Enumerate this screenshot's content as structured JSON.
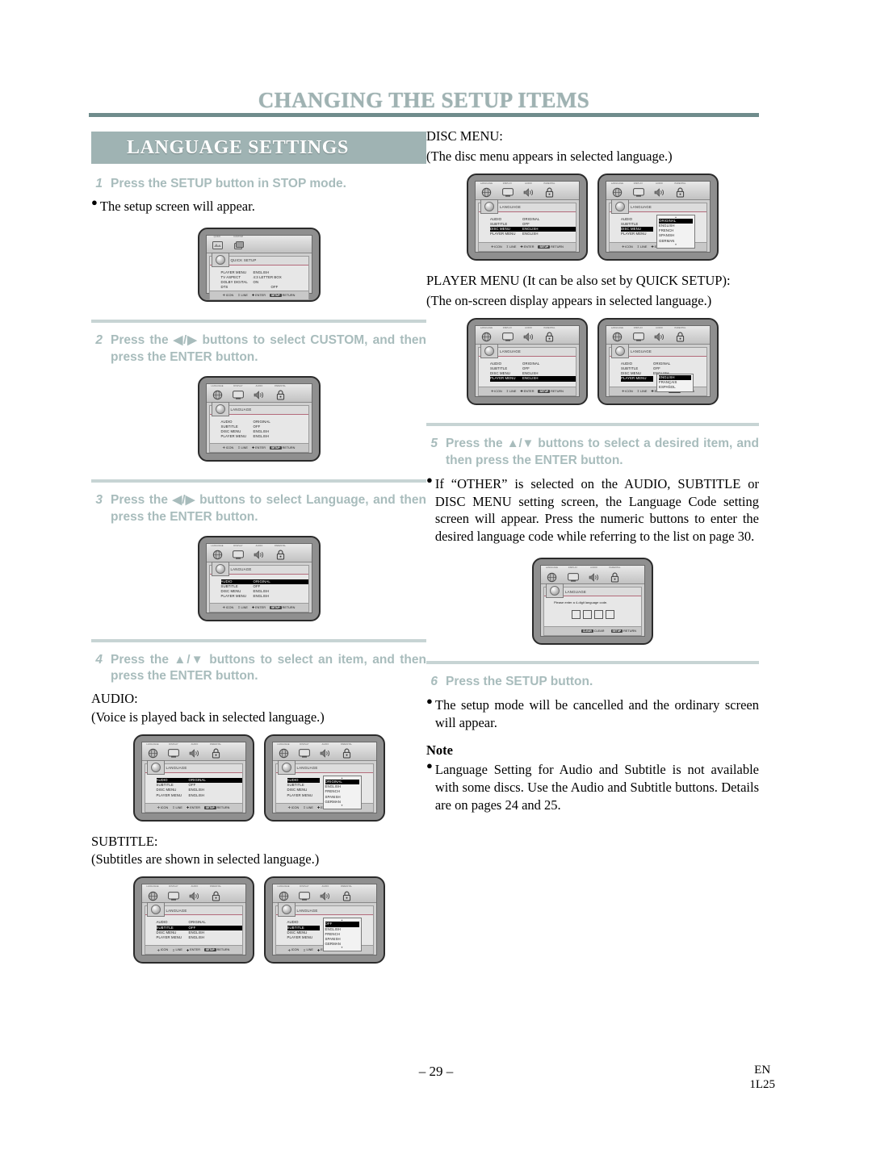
{
  "header": {
    "title": "CHANGING THE SETUP ITEMS"
  },
  "section": {
    "banner_title": "LANGUAGE SETTINGS"
  },
  "footer": {
    "page_number": "– 29 –",
    "lang_code": "EN",
    "doc_code": "1L25"
  },
  "steps": {
    "s1": {
      "num": "1",
      "text": "Press the SETUP button in STOP mode.",
      "bullet": "The setup screen will appear."
    },
    "s2": {
      "num": "2",
      "text_pre": "Press the",
      "glyph": "◀/▶",
      "text_post": "buttons to select CUSTOM, and then press the ENTER button."
    },
    "s3": {
      "num": "3",
      "text_pre": "Press the",
      "glyph": "◀/▶",
      "text_post": "buttons to select Language, and then press the ENTER button."
    },
    "s4": {
      "num": "4",
      "text_pre": "Press the",
      "glyph": "▲/▼",
      "text_post": "buttons to select an item, and then press the ENTER button."
    },
    "s5": {
      "num": "5",
      "text_pre": "Press the",
      "glyph": "▲/▼",
      "text_post": "buttons to select a desired item, and then press the ENTER button."
    },
    "s6": {
      "num": "6",
      "text": "Press the SETUP button."
    }
  },
  "left_labels": {
    "audio_heading": "AUDIO:",
    "audio_desc": "(Voice is played back in selected language.)",
    "subtitle_heading": "SUBTITLE:",
    "subtitle_desc": "(Subtitles are shown in selected language.)"
  },
  "right_labels": {
    "disc_menu_heading": "DISC MENU:",
    "disc_menu_desc": "(The disc menu appears in selected language.)",
    "player_menu_heading": "PLAYER MENU (It can be also set by QUICK SETUP):",
    "player_menu_desc": "(The on-screen display appears in selected language.)",
    "step5_bullet": "If “OTHER” is selected on the AUDIO, SUBTITLE or DISC MENU setting screen, the Language Code setting screen will appear. Press the numeric buttons to enter the desired language code while referring to the list on page 30.",
    "step6_bullet": "The setup mode will be cancelled and the ordinary screen will appear.",
    "note_heading": "Note",
    "note_bullet": "Language Setting for Audio and Subtitle is not available with some discs. Use the Audio and Subtitle buttons. Details are on pages 24 and 25."
  },
  "osd": {
    "tabs_quick": [
      {
        "name": "QUICK",
        "icon": "quick-setup-icon"
      },
      {
        "name": "CUSTOM",
        "icon": "custom-setup-icon"
      }
    ],
    "tabs_custom": [
      {
        "name": "LANGUAGE",
        "icon": "globe-icon"
      },
      {
        "name": "DISPLAY",
        "icon": "tv-icon"
      },
      {
        "name": "AUDIO",
        "icon": "speaker-icon"
      },
      {
        "name": "PARENTAL",
        "icon": "lock-icon"
      }
    ],
    "quick_setup": {
      "title": "QUICK SETUP",
      "rows": [
        {
          "key": "PLAYER MENU",
          "value": "ENGLISH"
        },
        {
          "key": "TV ASPECT",
          "value": "4:3 LETTER BOX"
        },
        {
          "key": "DOLBY DIGITAL",
          "value": "ON"
        },
        {
          "key": "DTS",
          "value": "OFF"
        }
      ]
    },
    "language_panel": {
      "title": "LANGUAGE",
      "rows": [
        {
          "key": "AUDIO",
          "value": "ORIGINAL"
        },
        {
          "key": "SUBTITLE",
          "value": "OFF"
        },
        {
          "key": "DISC MENU",
          "value": "ENGLISH"
        },
        {
          "key": "PLAYER MENU",
          "value": "ENGLISH"
        }
      ]
    },
    "dropdowns": {
      "audio": [
        "ORIGINAL",
        "ENGLISH",
        "FRENCH",
        "SPANISH",
        "GERMAN"
      ],
      "subtitle": [
        "OFF",
        "ENGLISH",
        "FRENCH",
        "SPANISH",
        "GERMAN"
      ],
      "disc_menu": [
        "ORIGINAL",
        "ENGLISH",
        "FRENCH",
        "SPANISH",
        "GERMAN"
      ],
      "player_menu": [
        "ENGLISH",
        "FRANÇAIS",
        "ESPAÑOL"
      ]
    },
    "code_screen": {
      "title": "LANGUAGE",
      "message": "Please enter a 4-digit language code.",
      "boxes": 4
    },
    "helpbar": {
      "icon_label": "ICON",
      "line_label": "LINE",
      "enter_label": "ENTER",
      "return_label": "RETURN",
      "return_key": "SETUP"
    },
    "helpbar_code": {
      "clear_label": "CLEAR",
      "clear_key": "CLEAR",
      "return_label": "RETURN",
      "return_key": "SETUP"
    }
  }
}
